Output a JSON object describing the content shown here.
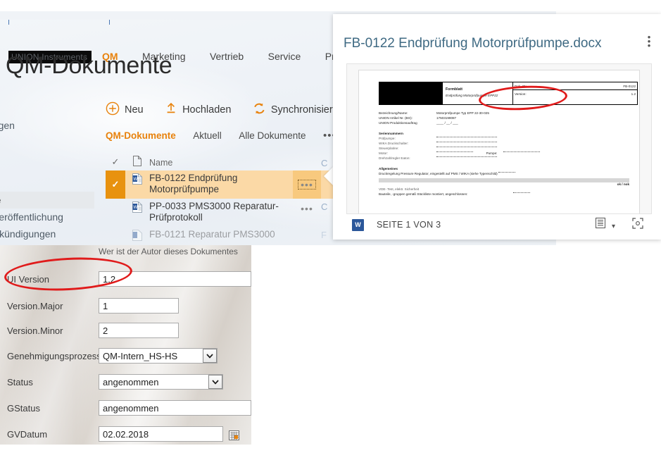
{
  "suite": {
    "logo": "UNION Instruments",
    "nav": [
      {
        "label": "QM",
        "active": true
      },
      {
        "label": "Marketing",
        "active": false
      },
      {
        "label": "Vertrieb",
        "active": false
      },
      {
        "label": "Service",
        "active": false
      },
      {
        "label": "Pro",
        "active": false
      }
    ]
  },
  "page": {
    "title": "QM-Dokumente"
  },
  "left_nav": [
    {
      "label": "ungen",
      "selected": false
    },
    {
      "label": "nte",
      "selected": true
    },
    {
      "label": "t Veröffentlichung",
      "selected": false
    },
    {
      "label": "Ankündigungen",
      "selected": false
    }
  ],
  "commands": [
    {
      "label": "Neu",
      "icon": "plus-circle-icon"
    },
    {
      "label": "Hochladen",
      "icon": "upload-arrow-icon"
    },
    {
      "label": "Synchronisieren",
      "icon": "sync-icon"
    }
  ],
  "views": {
    "items": [
      {
        "label": "QM-Dokumente",
        "active": true
      },
      {
        "label": "Aktuell",
        "active": false
      },
      {
        "label": "Alle Dokumente",
        "active": false
      }
    ],
    "more": "•••"
  },
  "list": {
    "header": {
      "name": "Name",
      "check_icon": "checkmark-icon",
      "type_icon": "document-icon"
    },
    "rows": [
      {
        "name": "FB-0122 Endprüfung Motorprüfpumpe",
        "icon": "word-document-icon",
        "selected": true,
        "menu": "•••"
      },
      {
        "name": "PP-0033 PMS3000 Reparatur-Prüfprotokoll",
        "icon": "word-document-icon",
        "selected": false,
        "menu": "•••"
      },
      {
        "name": "FB-0121 Reparatur PMS3000",
        "icon": "word-document-icon",
        "selected": false,
        "menu": ""
      }
    ]
  },
  "preview": {
    "title": "FB-0122 Endprüfung Motorprüfpumpe.docx",
    "kebab": "⋮",
    "footer": {
      "app_badge": "W",
      "pages": "SEITE 1 VON 3",
      "view_icon": "page-view-icon",
      "caret": "▾",
      "fullscreen_icon": "expand-icon"
    },
    "document": {
      "header": {
        "form_kind": "Formblatt",
        "form_name": "Endprüfung  Motorprüfpumpe  EPP22",
        "dok_id_label": "Dok.-ID:",
        "dok_id_value": "FB-0122",
        "version_label": "Version:",
        "version_value": "1.2"
      },
      "ident": [
        {
          "key": "Bezeichnung/Name:",
          "value": "Motorprüfpumpe Typ EPP 22-30-025"
        },
        {
          "key": "UNION  Artikel Nr. (BG):",
          "value": "17503199087"
        },
        {
          "key": "UNION  Produktionsauftrag",
          "value": "____ / __ / ___"
        }
      ],
      "serial_title": "Seriennummern",
      "serials": [
        {
          "key": "Prüfpumpe:"
        },
        {
          "key": "WIKA Druckschalter:"
        },
        {
          "key": "Steuerplatine:"
        },
        {
          "key": "Motor:",
          "key2": "Pumpe:"
        },
        {
          "key": "Drehzahlregler Eaton:"
        }
      ],
      "general_title": "Allgemeines",
      "general_line": "Druckregelung   Pressure Regulator, eingestellt auf PMS / WIKA  (siehe Typenschild)",
      "oknok": "ok / nok",
      "vde_line": "VDE- Test, elektr. Sicherheit",
      "parts_line": "Bauteile, -gruppen gemäß Stückliste montiert, angeschlossen:"
    }
  },
  "properties": {
    "author_hint": "Wer ist der Autor dieses Dokumentes",
    "fields": [
      {
        "label": "UI Version",
        "value": "1.2",
        "control": "text",
        "width": "full"
      },
      {
        "label": "Version.Major",
        "value": "1",
        "control": "text",
        "width": "mid"
      },
      {
        "label": "Version.Minor",
        "value": "2",
        "control": "text",
        "width": "mid"
      },
      {
        "label": "Genehmigungsprozess",
        "value": "QM-Intern_HS-HS",
        "control": "select",
        "width": "sel"
      },
      {
        "label": "Status",
        "value": "angenommen",
        "control": "select",
        "width": "date"
      },
      {
        "label": "GStatus",
        "value": "angenommen",
        "control": "text",
        "width": "full"
      },
      {
        "label": "GVDatum",
        "value": "02.02.2018",
        "control": "date",
        "width": "date"
      }
    ],
    "select_caret": "⌄",
    "calendar_icon": "calendar-icon"
  },
  "annotations": {
    "ellipse_color": "#e01b1b",
    "marks": [
      "version-field-in-document",
      "ui-version-row-in-properties"
    ]
  },
  "colors": {
    "accent_orange": "#e8820c",
    "selected_row": "#fbd9a6",
    "title_blue": "#3f6a83",
    "word_blue": "#2b579a"
  }
}
